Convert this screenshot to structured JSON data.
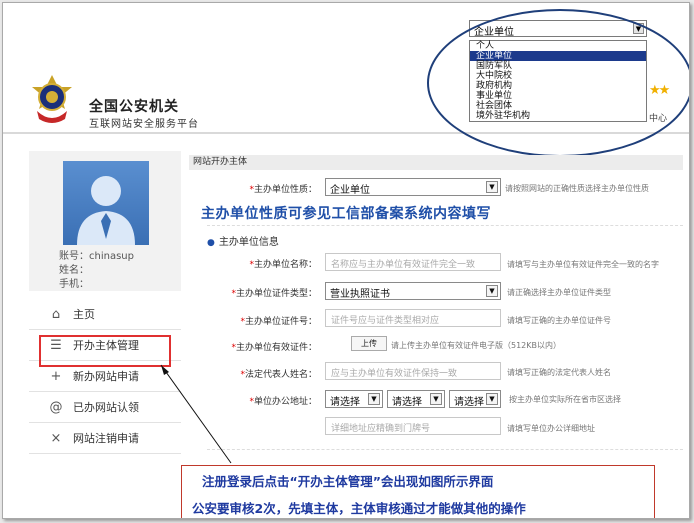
{
  "brand": {
    "title": "全国公安机关",
    "subtitle": "互联网站安全服务平台"
  },
  "header": {
    "stars": "★★",
    "link_suffix": "中心"
  },
  "type_dropdown": {
    "selected": "企业单位",
    "options": [
      "个人",
      "企业单位",
      "国防军队",
      "大中院校",
      "政府机构",
      "事业单位",
      "社会团体",
      "境外驻华机构"
    ],
    "highlight_index": 1
  },
  "profile": {
    "account": "账号：chinasup",
    "name": "姓名：",
    "phone": "手机："
  },
  "menu": {
    "items": [
      {
        "label": "主页",
        "icon": "home-icon"
      },
      {
        "label": "开办主体管理",
        "icon": "list-icon"
      },
      {
        "label": "新办网站申请",
        "icon": "plus-icon"
      },
      {
        "label": "已办网站认领",
        "icon": "at-icon"
      },
      {
        "label": "网站注销申请",
        "icon": "close-icon"
      }
    ]
  },
  "form": {
    "section_title": "网站开办主体",
    "unit_type": {
      "label": "主办单位性质：",
      "value": "企业单位",
      "hint": "请按照网站的正确性质选择主办单位性质"
    },
    "note": "主办单位性质可参见工信部备案系统内容填写",
    "info_title": "主办单位信息",
    "unit_name": {
      "label": "主办单位名称：",
      "placeholder": "名称应与主办单位有效证件完全一致",
      "hint": "请填写与主办单位有效证件完全一致的名字"
    },
    "cert_type": {
      "label": "主办单位证件类型：",
      "value": "营业执照证书",
      "hint": "请正确选择主办单位证件类型"
    },
    "cert_no": {
      "label": "主办单位证件号：",
      "placeholder": "证件号应与证件类型相对应",
      "hint": "请填写正确的主办单位证件号"
    },
    "cert_file": {
      "label": "主办单位有效证件：",
      "button": "上传",
      "hint": "请上传主办单位有效证件电子版（512KB以内）"
    },
    "legal_rep": {
      "label": "法定代表人姓名：",
      "placeholder": "应与主办单位有效证件保持一致",
      "hint": "请填写正确的法定代表人姓名"
    },
    "address": {
      "label": "单位办公地址：",
      "selects": [
        "请选择",
        "请选择",
        "请选择"
      ],
      "hint": "按主办单位实际所在省市区选择",
      "detail_placeholder": "详细地址应精确到门牌号",
      "detail_hint": "请填写单位办公详细地址"
    }
  },
  "annotation": {
    "line1": "注册登录后点击“开办主体管理”会出现如图所示界面",
    "line2": "公安要审核2次，先填主体，主体审核通过才能做其他的操作"
  },
  "colors": {
    "accent_blue": "#1f4fa8",
    "highlight_red": "#e03030",
    "selected_option": "#1c3a8c"
  }
}
